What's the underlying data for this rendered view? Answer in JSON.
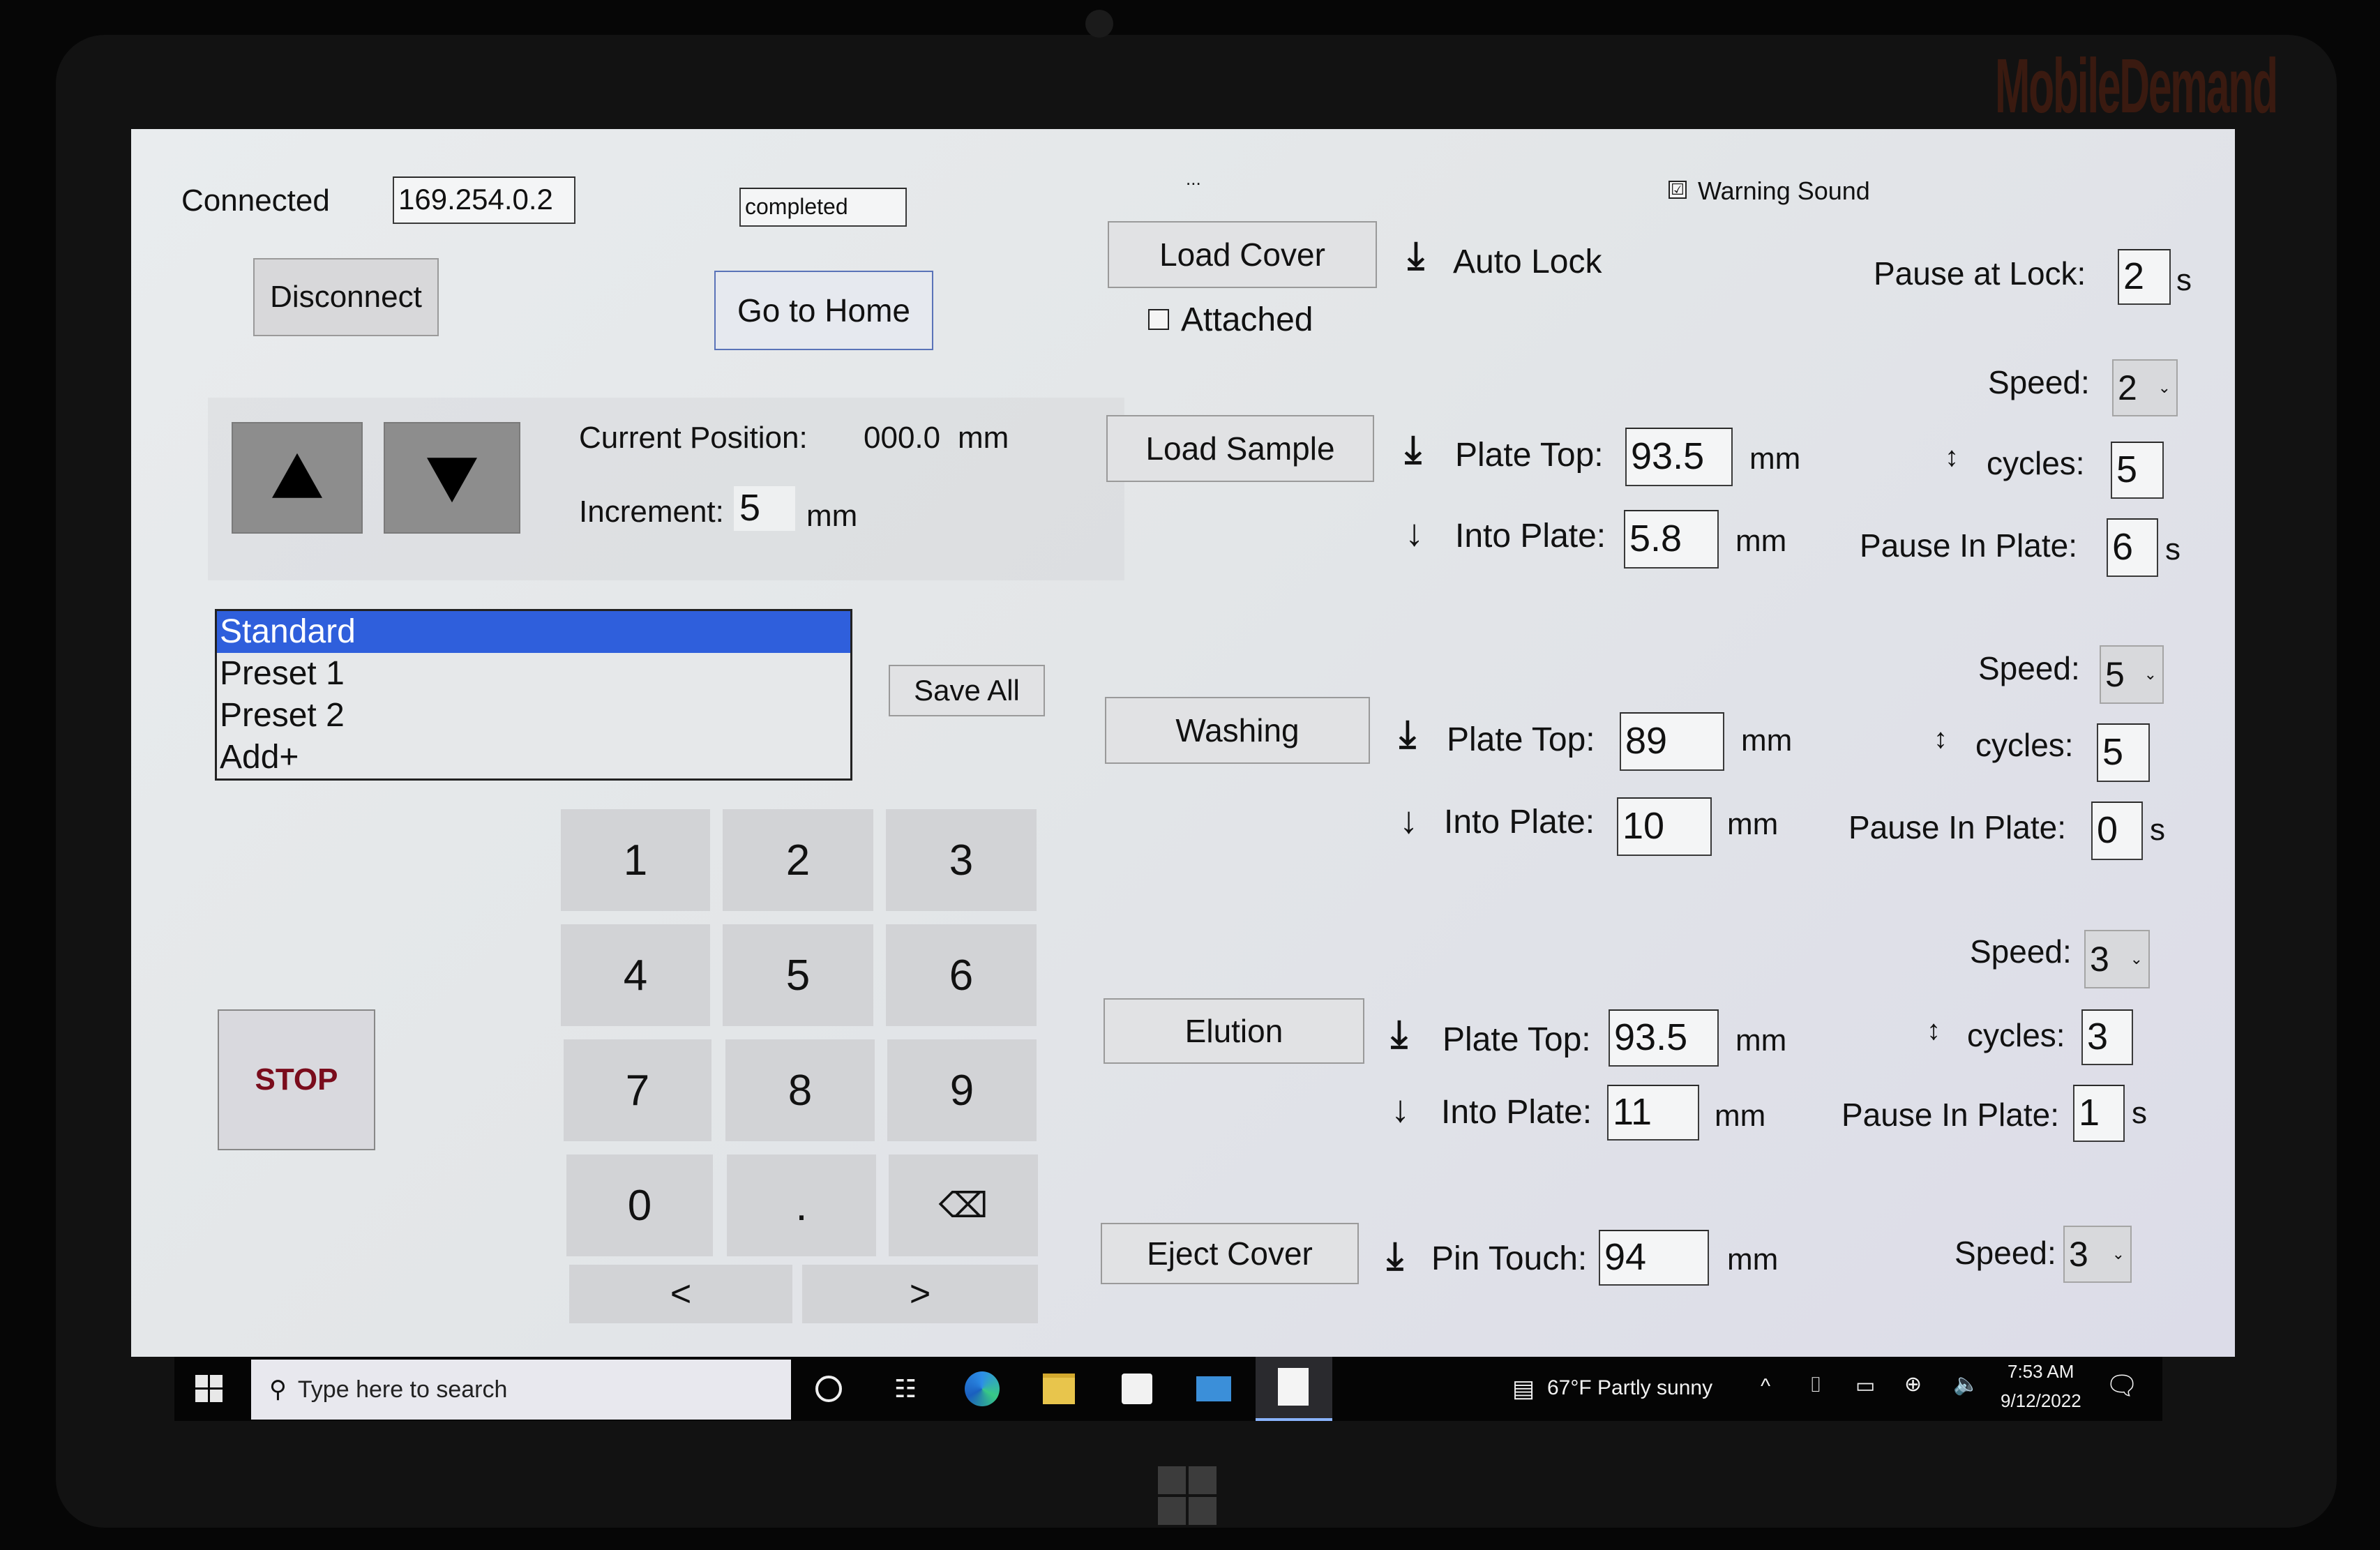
{
  "device": {
    "brand": "MobileDemand"
  },
  "connection": {
    "status_label": "Connected",
    "ip_address": "169.254.0.2",
    "disconnect_label": "Disconnect",
    "state_value": "completed",
    "go_home_label": "Go to Home",
    "ellipsis": "..."
  },
  "jog": {
    "up_icon": "triangle-up-icon",
    "down_icon": "triangle-down-icon",
    "current_position_label": "Current Position:",
    "current_position_value": "000.0",
    "current_position_unit": "mm",
    "increment_label": "Increment:",
    "increment_value": "5",
    "increment_unit": "mm"
  },
  "presets": {
    "items": [
      {
        "label": "Standard",
        "selected": true
      },
      {
        "label": "Preset 1",
        "selected": false
      },
      {
        "label": "Preset 2",
        "selected": false
      },
      {
        "label": "Add+",
        "selected": false
      }
    ],
    "save_all_label": "Save All"
  },
  "keypad": {
    "keys": [
      "1",
      "2",
      "3",
      "4",
      "5",
      "6",
      "7",
      "8",
      "9",
      "0",
      ".",
      "⌫"
    ],
    "backspace_icon": "backspace-icon",
    "left_label": "<",
    "right_label": ">"
  },
  "stop_label": "STOP",
  "warning_sound": {
    "label": "Warning Sound",
    "checked": true,
    "check_glyph": "☑"
  },
  "load_cover": {
    "button_label": "Load Cover",
    "auto_lock_label": "Auto Lock",
    "attached_label": "Attached",
    "attached_checked": false,
    "pause_at_lock_label": "Pause at Lock:",
    "pause_at_lock_value": "2",
    "pause_unit": "s",
    "speed_label": "Speed:",
    "speed_value": "2"
  },
  "load_sample": {
    "button_label": "Load Sample",
    "plate_top_label": "Plate Top:",
    "plate_top_value": "93.5",
    "into_plate_label": "Into Plate:",
    "into_plate_value": "5.8",
    "unit": "mm",
    "cycles_label": "cycles:",
    "cycles_value": "5",
    "pause_in_plate_label": "Pause In Plate:",
    "pause_in_plate_value": "6",
    "pause_unit": "s",
    "speed_label": "Speed:",
    "speed_value": "5"
  },
  "washing": {
    "button_label": "Washing",
    "plate_top_label": "Plate Top:",
    "plate_top_value": "89",
    "into_plate_label": "Into Plate:",
    "into_plate_value": "10",
    "unit": "mm",
    "cycles_label": "cycles:",
    "cycles_value": "5",
    "pause_in_plate_label": "Pause In Plate:",
    "pause_in_plate_value": "0",
    "pause_unit": "s",
    "speed_label": "Speed:",
    "speed_value": "3"
  },
  "elution": {
    "button_label": "Elution",
    "plate_top_label": "Plate Top:",
    "plate_top_value": "93.5",
    "into_plate_label": "Into Plate:",
    "into_plate_value": "11",
    "unit": "mm",
    "cycles_label": "cycles:",
    "cycles_value": "3",
    "pause_in_plate_label": "Pause In Plate:",
    "pause_in_plate_value": "1",
    "pause_unit": "s"
  },
  "eject_cover": {
    "button_label": "Eject Cover",
    "pin_touch_label": "Pin Touch:",
    "pin_touch_value": "94",
    "unit": "mm",
    "speed_label": "Speed:",
    "speed_value": "3"
  },
  "glyphs": {
    "arrow_down": "⤓",
    "arrow_down_short": "↓",
    "arrow_updown": "↕",
    "chevron_down": "⌄"
  },
  "taskbar": {
    "search_placeholder": "Type here to search",
    "weather": "67°F  Partly sunny",
    "time": "7:53 AM",
    "date": "9/12/2022",
    "tray_chevron": "^"
  }
}
